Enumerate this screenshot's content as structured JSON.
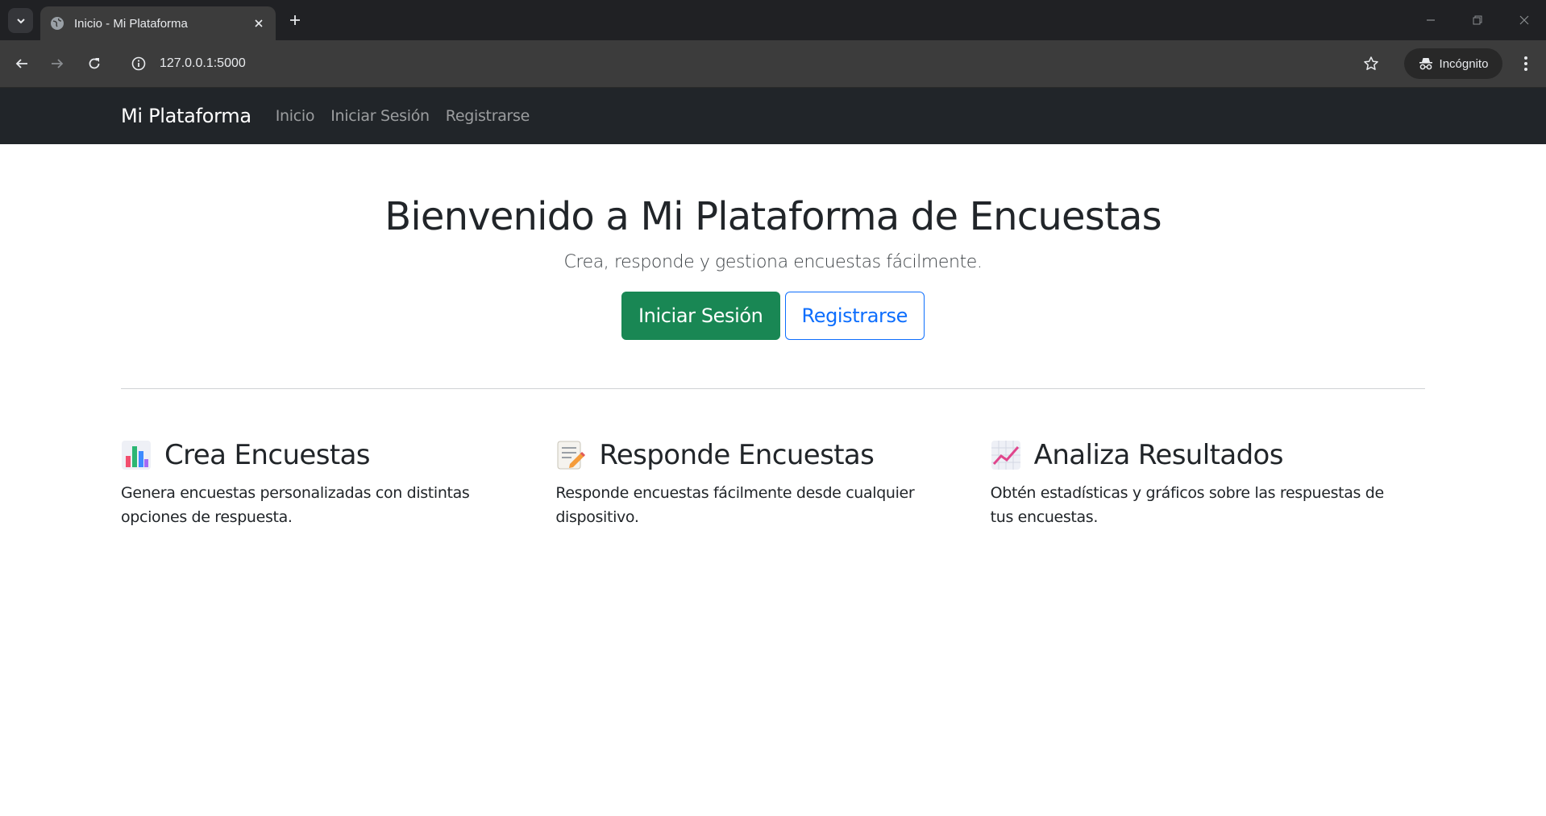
{
  "browser": {
    "tab_title": "Inicio - Mi Plataforma",
    "url": "127.0.0.1:5000",
    "incognito_label": "Incógnito"
  },
  "navbar": {
    "brand": "Mi Plataforma",
    "links": [
      "Inicio",
      "Iniciar Sesión",
      "Registrarse"
    ]
  },
  "hero": {
    "title": "Bienvenido a Mi Plataforma de Encuestas",
    "subtitle": "Crea, responde y gestiona encuestas fácilmente.",
    "login_button": "Iniciar Sesión",
    "register_button": "Registrarse"
  },
  "features": [
    {
      "icon": "bar-chart-icon",
      "title": "Crea Encuestas",
      "text": "Genera encuestas personalizadas con distintas opciones de respuesta."
    },
    {
      "icon": "memo-icon",
      "title": "Responde Encuestas",
      "text": "Responde encuestas fácilmente desde cualquier dispositivo."
    },
    {
      "icon": "trending-up-icon",
      "title": "Analiza Resultados",
      "text": "Obtén estadísticas y gráficos sobre las respuestas de tus encuestas."
    }
  ],
  "colors": {
    "navbar_bg": "#212529",
    "success": "#198754",
    "primary": "#0d6efd",
    "chrome_dark": "#202124",
    "chrome_toolbar": "#3c3c3c"
  }
}
